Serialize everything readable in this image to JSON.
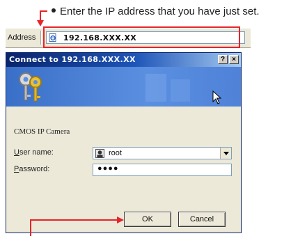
{
  "annotation": {
    "text": "Enter the IP address that you have just set."
  },
  "address_bar": {
    "label": "Address",
    "url": "192.168.XXX.XX",
    "page_icon": "ie-page-icon"
  },
  "dialog": {
    "title": "Connect to 192.168.XXX.XX",
    "help_button": "?",
    "close_button": "×",
    "banner_icon": "keys-icon",
    "site_label": "CMOS IP Camera",
    "username_label": "User name:",
    "username_value": "root",
    "user_icon": "user-icon",
    "password_label": "Password:",
    "password_value": "●●●●",
    "ok_label": "OK",
    "cancel_label": "Cancel"
  },
  "colors": {
    "highlight": "#e8232a",
    "title_bar": "#0a246a",
    "banner": "#4f82d8"
  }
}
